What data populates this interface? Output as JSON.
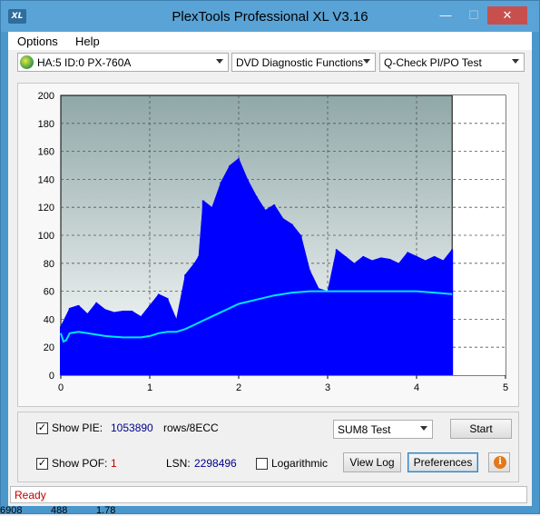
{
  "window": {
    "title": "PlexTools Professional XL V3.16",
    "icon_text": "XL",
    "min_label": "—",
    "max_label": "☐",
    "close_label": "✕"
  },
  "menu": [
    {
      "label": "Options",
      "accel": "O"
    },
    {
      "label": "Help",
      "accel": "H"
    }
  ],
  "toolbar": {
    "drive": "HA:5 ID:0  PX-760A",
    "function": "DVD Diagnostic Functions",
    "test": "Q-Check PI/PO Test"
  },
  "chart_data": {
    "type": "area",
    "x_ticks": [
      "0",
      "1",
      "2",
      "3",
      "4",
      "5"
    ],
    "y_ticks": [
      "0",
      "20",
      "40",
      "60",
      "80",
      "100",
      "120",
      "140",
      "160",
      "180",
      "200"
    ],
    "xlim": [
      0,
      5
    ],
    "ylim": [
      0,
      200
    ],
    "grid": true,
    "end_marker_x": 4.4,
    "series": [
      {
        "type": "bar",
        "color": "#0000ff",
        "x": [
          0.0,
          0.1,
          0.2,
          0.3,
          0.4,
          0.5,
          0.6,
          0.7,
          0.8,
          0.9,
          1.0,
          1.1,
          1.2,
          1.3,
          1.4,
          1.5,
          1.55,
          1.6,
          1.7,
          1.8,
          1.9,
          2.0,
          2.1,
          2.2,
          2.3,
          2.4,
          2.5,
          2.6,
          2.7,
          2.8,
          2.9,
          3.0,
          3.1,
          3.2,
          3.3,
          3.4,
          3.5,
          3.6,
          3.7,
          3.8,
          3.9,
          4.0,
          4.1,
          4.2,
          4.3,
          4.4
        ],
        "y": [
          35,
          48,
          50,
          44,
          52,
          47,
          45,
          46,
          46,
          42,
          50,
          58,
          55,
          40,
          72,
          80,
          85,
          125,
          120,
          138,
          150,
          155,
          140,
          128,
          118,
          122,
          112,
          108,
          100,
          75,
          62,
          60,
          90,
          85,
          80,
          85,
          82,
          84,
          83,
          80,
          88,
          85,
          82,
          85,
          82,
          90
        ]
      },
      {
        "type": "line",
        "color": "#00e5ff",
        "x": [
          0.0,
          0.03,
          0.06,
          0.1,
          0.2,
          0.3,
          0.5,
          0.7,
          0.9,
          1.0,
          1.1,
          1.2,
          1.3,
          1.4,
          1.5,
          1.6,
          1.7,
          1.8,
          1.9,
          2.0,
          2.2,
          2.4,
          2.6,
          2.8,
          3.0,
          3.2,
          3.5,
          4.0,
          4.2,
          4.4
        ],
        "y": [
          30,
          24,
          25,
          30,
          31,
          30,
          28,
          27,
          27,
          28,
          30,
          31,
          31,
          33,
          36,
          39,
          42,
          45,
          48,
          51,
          54,
          57,
          59,
          60,
          60,
          60,
          60,
          60,
          59,
          58
        ]
      }
    ]
  },
  "controls": {
    "show_pie_label": "Show PIE:",
    "pie_value": "1053890",
    "pie_units": "rows/8ECC",
    "show_poe_label": "Show POF:",
    "poe_value": "1",
    "lsn_label": "LSN:",
    "lsn_value": "2298496",
    "log_label": "Logarithmic",
    "sum_select": "SUM8 Test",
    "start_button": "Start",
    "view_log_button": "View Log",
    "preferences_button": "Preferences",
    "info_glyph": "i",
    "show_pie_checked": "✓",
    "show_poe_checked": "✓"
  },
  "status": {
    "text": "Ready"
  },
  "background_text": {
    "c1": "6908",
    "c2": "488",
    "c3": "1.78"
  }
}
